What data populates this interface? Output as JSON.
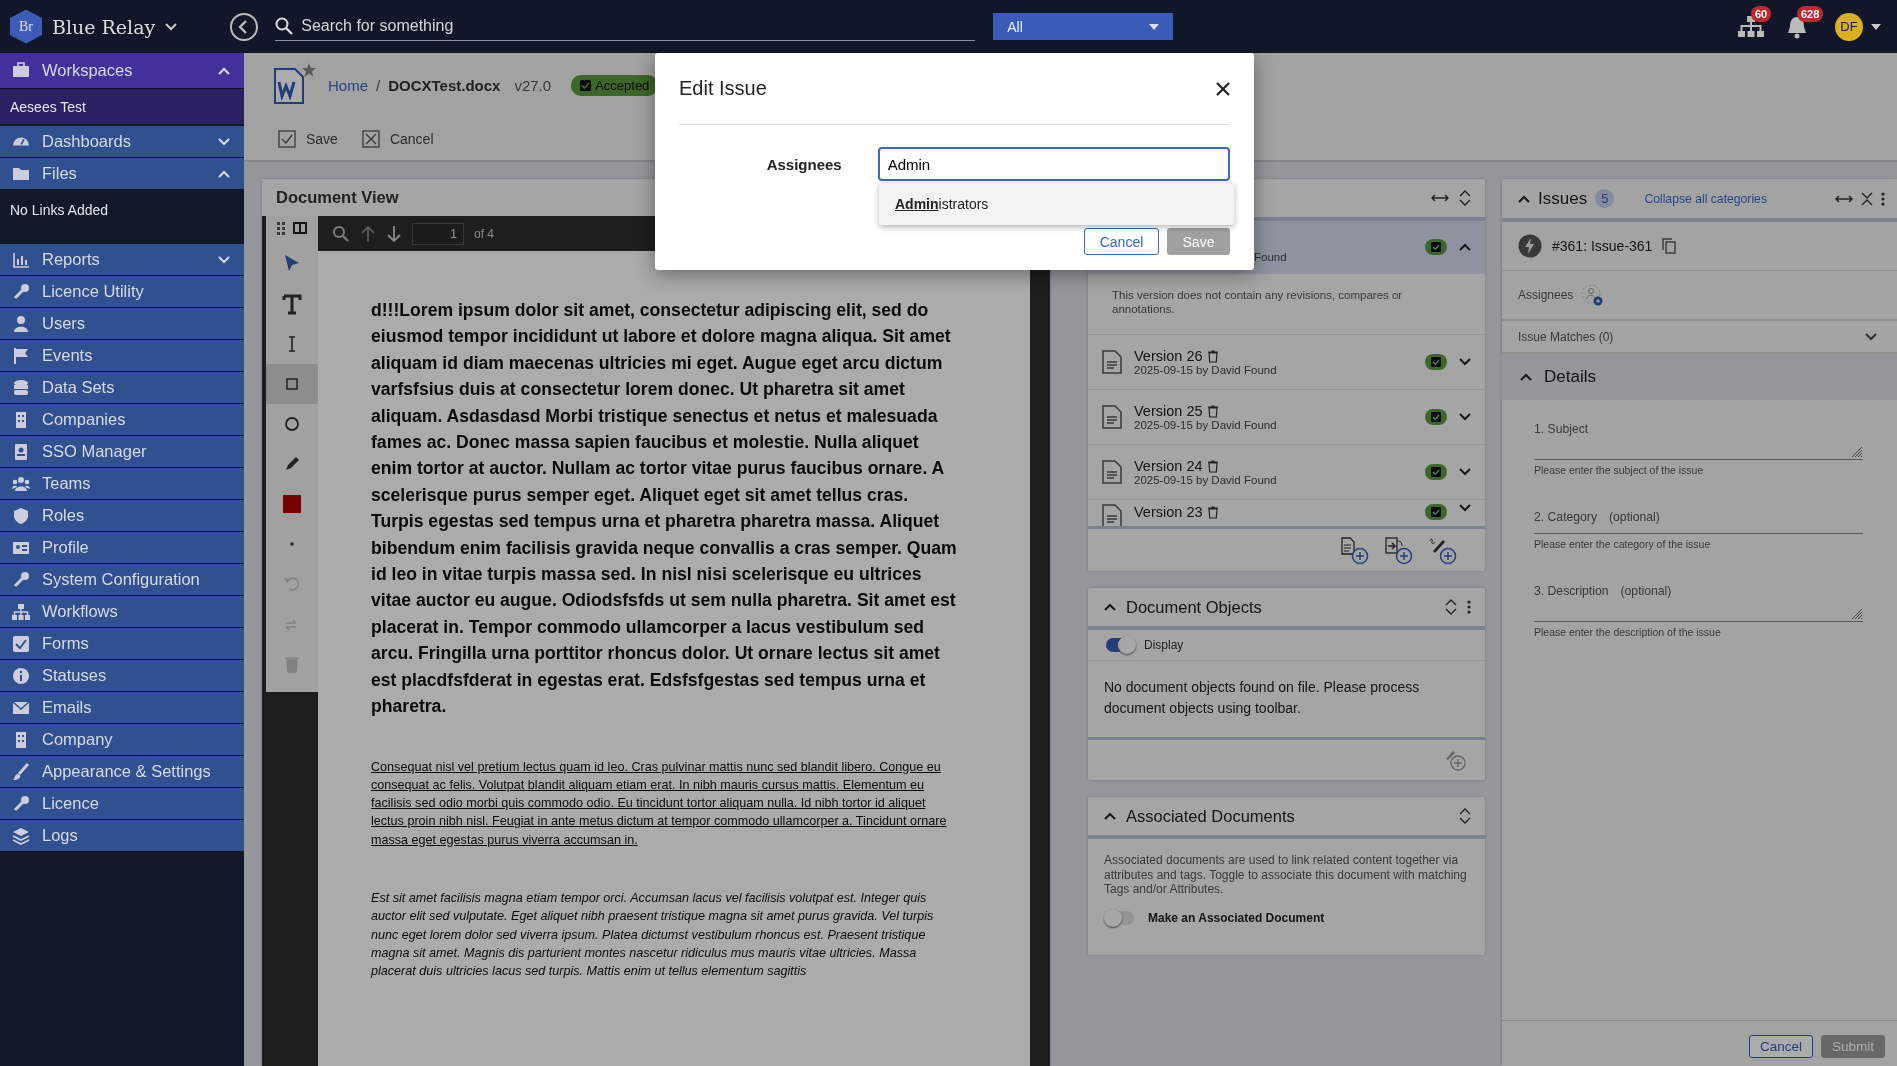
{
  "app": {
    "name": "Blue Relay",
    "logo": "Br"
  },
  "search": {
    "placeholder": "Search for something",
    "scope": "All"
  },
  "notifications": [
    {
      "kind": "network",
      "count": "60"
    },
    {
      "kind": "bell",
      "count": "628"
    }
  ],
  "user": {
    "initials": "DF"
  },
  "sidebar": {
    "items": [
      {
        "label": "Workspaces",
        "kind": "group",
        "selected": true,
        "expanded": true,
        "children": [
          {
            "label": "Aesees Test"
          }
        ]
      },
      {
        "label": "Dashboards",
        "kind": "group",
        "selected": false,
        "expanded": false
      },
      {
        "label": "Files",
        "kind": "group",
        "selected": false,
        "expanded": true,
        "children": [
          {
            "label": "No Links Added"
          }
        ]
      },
      {
        "label": "Reports",
        "kind": "group",
        "selected": false,
        "expanded": false
      },
      {
        "label": "Licence Utility",
        "kind": "link",
        "selected": false
      },
      {
        "label": "Users",
        "kind": "link",
        "selected": false
      },
      {
        "label": "Events",
        "kind": "link",
        "selected": false
      },
      {
        "label": "Data Sets",
        "kind": "link",
        "selected": false
      },
      {
        "label": "Companies",
        "kind": "link",
        "selected": false
      },
      {
        "label": "SSO Manager",
        "kind": "link",
        "selected": false
      },
      {
        "label": "Teams",
        "kind": "link",
        "selected": false
      },
      {
        "label": "Roles",
        "kind": "link",
        "selected": false
      },
      {
        "label": "Profile",
        "kind": "link",
        "selected": false
      },
      {
        "label": "System Configuration",
        "kind": "link",
        "selected": false
      },
      {
        "label": "Workflows",
        "kind": "link",
        "selected": false
      },
      {
        "label": "Forms",
        "kind": "link",
        "selected": false
      },
      {
        "label": "Statuses",
        "kind": "link",
        "selected": false
      },
      {
        "label": "Emails",
        "kind": "link",
        "selected": false
      },
      {
        "label": "Company",
        "kind": "link",
        "selected": false
      },
      {
        "label": "Appearance & Settings",
        "kind": "link",
        "selected": false
      },
      {
        "label": "Licence",
        "kind": "link",
        "selected": false
      },
      {
        "label": "Logs",
        "kind": "link",
        "selected": false
      }
    ]
  },
  "document": {
    "breadcrumb": "Home",
    "separator": "/",
    "file": "DOCXTest.docx",
    "version": "v27.0",
    "status": "Accepted",
    "starred": false,
    "actions": [
      {
        "label": "Save",
        "kind": "check"
      },
      {
        "label": "Cancel",
        "kind": "cross"
      }
    ]
  },
  "viewer": {
    "title": "Document View",
    "page": "1",
    "page_count": "of 4",
    "tools": [
      {
        "kind": "pointer",
        "selected": false,
        "disabled": false
      },
      {
        "kind": "text",
        "selected": false,
        "disabled": false
      },
      {
        "kind": "ibeam",
        "selected": false,
        "disabled": false
      },
      {
        "kind": "rect",
        "selected": true,
        "disabled": false
      },
      {
        "kind": "circle",
        "selected": false,
        "disabled": false
      },
      {
        "kind": "pencil",
        "selected": false,
        "disabled": false
      },
      {
        "kind": "swatch",
        "selected": false,
        "disabled": false
      },
      {
        "kind": "dot",
        "selected": false,
        "disabled": false
      },
      {
        "kind": "undo",
        "selected": false,
        "disabled": true
      },
      {
        "kind": "redo",
        "selected": false,
        "disabled": true
      },
      {
        "kind": "trash",
        "selected": false,
        "disabled": true
      }
    ],
    "paragraphs": [
      {
        "kind": "bold",
        "text": "d!!!Lorem ipsum dolor sit amet, consectetur adipiscing elit, sed do eiusmod tempor incididunt ut labore et dolore magna aliqua. Sit amet aliquam id diam maecenas ultricies mi eget. Augue eget arcu dictum varfsfsius duis at consectetur lorem donec. Ut pharetra sit amet aliquam. Asdasdasd Morbi tristique senectus et netus et malesuada fames ac. Donec massa sapien faucibus et molestie. Nulla aliquet enim tortor at auctor. Nullam ac tortor vitae purus faucibus ornare. A scelerisque purus semper eget. Aliquet eget sit amet tellus cras. Turpis egestas sed tempus urna et pharetra pharetra massa. Aliquet bibendum enim facilisis gravida neque convallis a cras semper. Quam id leo in vitae turpis massa sed. In nisl nisi scelerisque eu ultrices vitae auctor eu augue. Odiodsfsfds ut sem nulla pharetra. Sit amet est placerat in. Tempor commodo ullamcorper a lacus vestibulum sed arcu. Fringilla urna porttitor rhoncus dolor. Ut ornare lectus sit amet est placdfsfderat in egestas erat. Edsfsfgestas sed tempus urna et pharetra."
      },
      {
        "kind": "underline",
        "text": "Consequat nisl vel pretium lectus quam id leo. Cras pulvinar mattis nunc sed blandit libero. Congue eu consequat ac felis. Volutpat blandit aliquam etiam erat. In nibh mauris cursus mattis. Elementum eu facilisis sed odio morbi quis commodo odio. Eu tincidunt tortor aliquam nulla. Id nibh tortor id aliquet lectus proin nibh nisl. Feugiat in ante metus dictum at tempor commodo ullamcorper a. Tincidunt ornare massa eget egestas purus viverra accumsan in."
      },
      {
        "kind": "italic",
        "text": "Est sit amet facilisis magna etiam tempor orci. Accumsan lacus vel facilisis volutpat est. Integer quis auctor elit sed vulputate. Eget aliquet nibh praesent tristique magna sit amet purus gravida. Vel turpis nunc eget lorem dolor sed viverra ipsum. Platea dictumst vestibulum rhoncus est. Praesent tristique magna sit amet. Magnis dis parturient montes nascetur ridiculus mus mauris vitae ultricies. Massa placerat duis ultricies lacus sed turpis. Mattis enim ut tellus elementum sagittis"
      }
    ]
  },
  "versions": {
    "rows": [
      {
        "text": "Found",
        "note": "This version does not contain any revisions, compares or annotations.",
        "selected": true,
        "expanded": true,
        "accepted": true
      },
      {
        "title": "Version 26",
        "date": "2025-09-15 by David Found",
        "selected": false,
        "expanded": false,
        "accepted": true
      },
      {
        "title": "Version 25",
        "date": "2025-09-15 by David Found",
        "selected": false,
        "expanded": false,
        "accepted": true
      },
      {
        "title": "Version 24",
        "date": "2025-09-15 by David Found",
        "selected": false,
        "expanded": false,
        "accepted": true
      },
      {
        "title": "Version 23",
        "selected": false,
        "expanded": false,
        "accepted": true
      }
    ]
  },
  "document_objects": {
    "title": "Document Objects",
    "expanded": true,
    "toggle": {
      "label": "Display",
      "on": true
    },
    "message": "No document objects found on file. Please process document objects using toolbar."
  },
  "associated_documents": {
    "title": "Associated Documents",
    "expanded": true,
    "description": "Associated documents are used to link related content together via attributes and tags. Toggle to associate this document with matching Tags and/or Attributes.",
    "toggle": {
      "label": "Make an Associated Document",
      "on": false
    }
  },
  "issues": {
    "title": "Issues",
    "count": "5",
    "link": "Collapse all categories",
    "issue": "#361: Issue-361",
    "assignees_label": "Assignees",
    "matches": "Issue Matches (0)",
    "matches_expanded": false,
    "details_title": "Details",
    "details_expanded": true,
    "fields": [
      {
        "label": "1. Subject",
        "kind": "textarea",
        "hint": "Please enter the subject of the issue"
      },
      {
        "label": "2. Category",
        "optional": "(optional)",
        "kind": "input",
        "hint": "Please enter the category of the issue"
      },
      {
        "label": "3. Description",
        "optional": "(optional)",
        "kind": "textarea",
        "hint": "Please enter the description of the issue"
      }
    ],
    "buttons": [
      {
        "label": "Cancel",
        "disabled": false
      },
      {
        "label": "Submit",
        "disabled": true
      }
    ]
  },
  "modal": {
    "title": "Edit Issue",
    "label": "Assignees",
    "value": "Admin",
    "suggestions": [
      "**Admin**istrators"
    ],
    "buttons": [
      {
        "label": "Cancel",
        "disabled": false
      },
      {
        "label": "Save",
        "disabled": true
      }
    ]
  }
}
